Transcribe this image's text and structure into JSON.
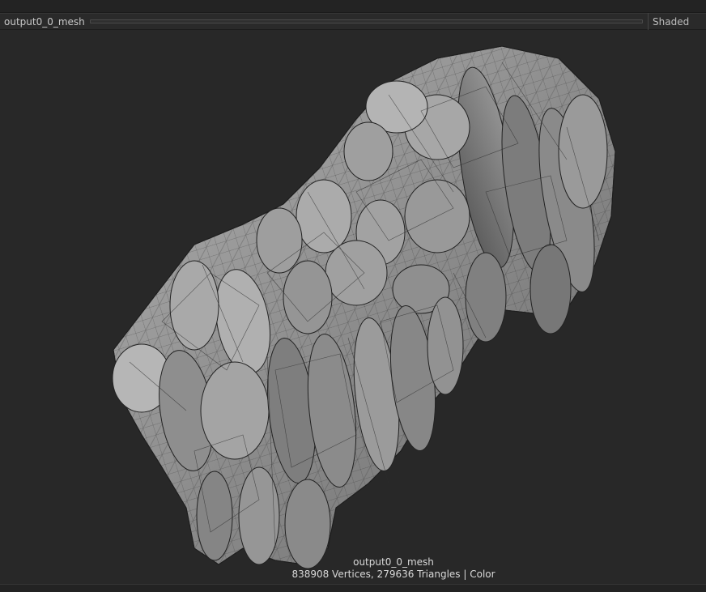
{
  "toolbar": {
    "mesh_title": "output0_0_mesh",
    "view_mode": "Shaded"
  },
  "viewport": {
    "overlay_name": "output0_0_mesh",
    "overlay_stats": "838908 Vertices, 279636 Triangles | Color",
    "background_color": "#282828",
    "mesh_color": "#8c8c8c"
  }
}
